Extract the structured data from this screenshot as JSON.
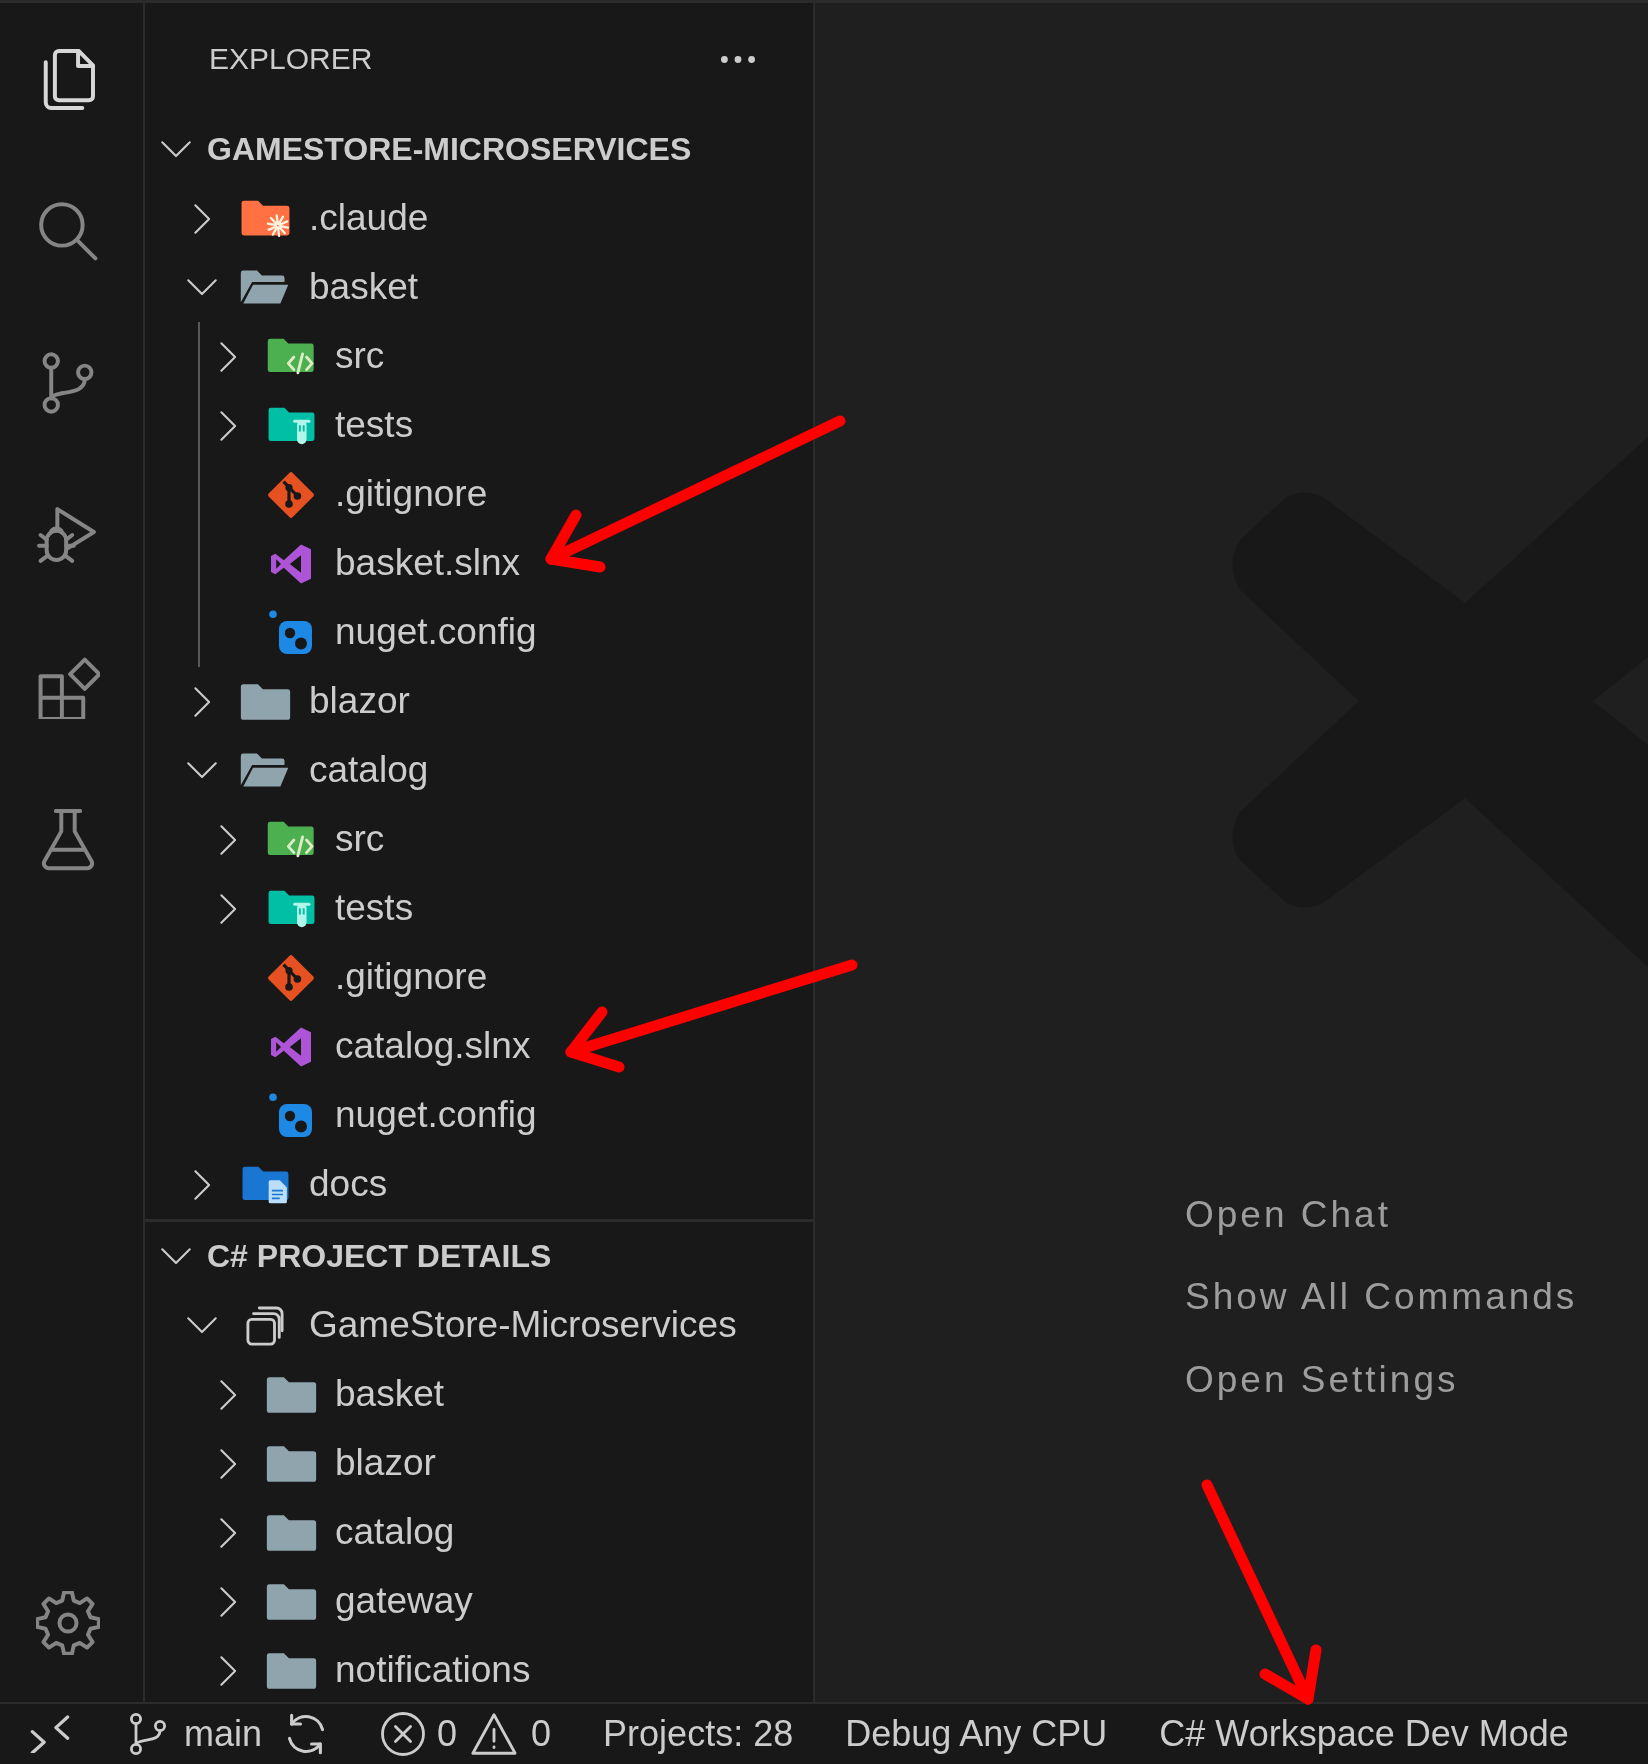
{
  "activity_bar": {
    "items": [
      {
        "kind": "explorer",
        "selected": true
      },
      {
        "kind": "search",
        "selected": false
      },
      {
        "kind": "source_control",
        "selected": false
      },
      {
        "kind": "run_debug",
        "selected": false
      },
      {
        "kind": "extensions",
        "selected": false
      },
      {
        "kind": "testing",
        "selected": false
      }
    ],
    "bottom_items": [
      {
        "kind": "settings"
      }
    ]
  },
  "sidebar": {
    "title": "EXPLORER",
    "sections": [
      {
        "title": "GAMESTORE-MICROSERVICES",
        "expanded": true,
        "tree": [
          {
            "label": ".claude",
            "kind": "folder_claude",
            "expanded": false
          },
          {
            "label": "basket",
            "kind": "folder",
            "expanded": true,
            "indent_guide": true,
            "children": [
              {
                "label": "src",
                "kind": "folder_src",
                "expanded": false
              },
              {
                "label": "tests",
                "kind": "folder_test",
                "expanded": false
              },
              {
                "label": ".gitignore",
                "kind": "file_git"
              },
              {
                "label": "basket.slnx",
                "kind": "file_solution"
              },
              {
                "label": "nuget.config",
                "kind": "file_nuget"
              }
            ]
          },
          {
            "label": "blazor",
            "kind": "folder",
            "expanded": false
          },
          {
            "label": "catalog",
            "kind": "folder",
            "expanded": true,
            "indent_guide": false,
            "children": [
              {
                "label": "src",
                "kind": "folder_src",
                "expanded": false
              },
              {
                "label": "tests",
                "kind": "folder_test",
                "expanded": false
              },
              {
                "label": ".gitignore",
                "kind": "file_git"
              },
              {
                "label": "catalog.slnx",
                "kind": "file_solution"
              },
              {
                "label": "nuget.config",
                "kind": "file_nuget"
              }
            ]
          },
          {
            "label": "docs",
            "kind": "folder_docs",
            "expanded": false
          }
        ]
      },
      {
        "title": "C# PROJECT DETAILS",
        "expanded": true,
        "tree": [
          {
            "label": "GameStore-Microservices",
            "kind": "solution",
            "expanded": true,
            "indent_guide": false,
            "children": [
              {
                "label": "basket",
                "kind": "folder",
                "expanded": false
              },
              {
                "label": "blazor",
                "kind": "folder",
                "expanded": false
              },
              {
                "label": "catalog",
                "kind": "folder",
                "expanded": false
              },
              {
                "label": "gateway",
                "kind": "folder",
                "expanded": false
              },
              {
                "label": "notifications",
                "kind": "folder",
                "expanded": false
              }
            ]
          }
        ]
      }
    ]
  },
  "editor": {
    "commands": [
      "Open Chat",
      "Show All Commands",
      "Open Settings"
    ]
  },
  "status_bar": {
    "items": [
      {
        "kind": "remote"
      },
      {
        "kind": "branch",
        "text": "main"
      },
      {
        "kind": "sync"
      },
      {
        "kind": "problems",
        "errors": "0",
        "warnings": "0"
      },
      {
        "kind": "text",
        "text": "Projects: 28"
      },
      {
        "kind": "text",
        "text": "Debug Any CPU"
      },
      {
        "kind": "text",
        "text": "C# Workspace Dev Mode"
      }
    ]
  }
}
